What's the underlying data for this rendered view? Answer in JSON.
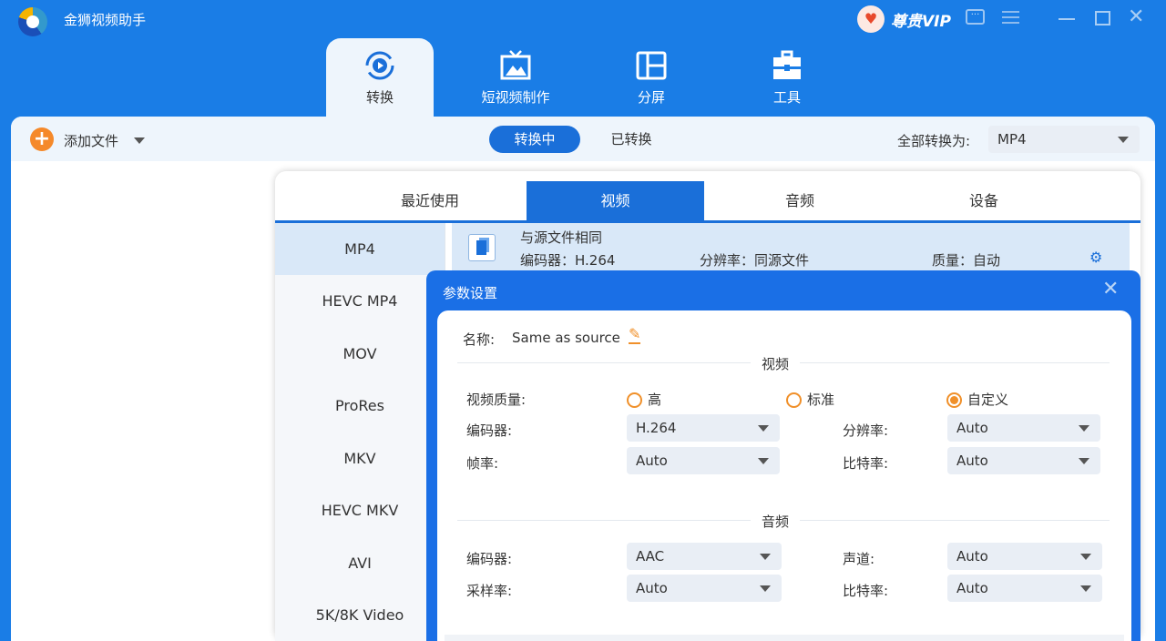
{
  "app": {
    "title": "金狮视频助手",
    "vip": "尊贵VIP"
  },
  "nav": [
    {
      "label": "转换"
    },
    {
      "label": "短视频制作"
    },
    {
      "label": "分屏"
    },
    {
      "label": "工具"
    }
  ],
  "toolbar": {
    "add_file": "添加文件",
    "converting": "转换中",
    "converted": "已转换",
    "convert_all_label": "全部转换为:",
    "convert_all_value": "MP4"
  },
  "format_tabs": [
    "最近使用",
    "视频",
    "音频",
    "设备"
  ],
  "formats": [
    "MP4",
    "HEVC MP4",
    "MOV",
    "ProRes",
    "MKV",
    "HEVC MKV",
    "AVI",
    "5K/8K Video"
  ],
  "preset": {
    "title": "与源文件相同",
    "encoder": "编码器：H.264",
    "resolution": "分辨率：同源文件",
    "quality": "质量：自动"
  },
  "dialog": {
    "title": "参数设置",
    "name_label": "名称:",
    "name_value": "Same as source",
    "video_section": "视频",
    "audio_section": "音频",
    "quality_label": "视频质量:",
    "quality_options": [
      "高",
      "标准",
      "自定义"
    ],
    "quality_selected": "自定义",
    "video_encoder_label": "编码器:",
    "video_encoder": "H.264",
    "resolution_label": "分辨率:",
    "resolution": "Auto",
    "frame_rate_label": "帧率:",
    "frame_rate": "Auto",
    "video_bitrate_label": "比特率:",
    "video_bitrate": "Auto",
    "audio_encoder_label": "编码器:",
    "audio_encoder": "AAC",
    "channel_label": "声道:",
    "channel": "Auto",
    "sample_rate_label": "采样率:",
    "sample_rate": "Auto",
    "audio_bitrate_label": "比特率:",
    "audio_bitrate": "Auto"
  }
}
